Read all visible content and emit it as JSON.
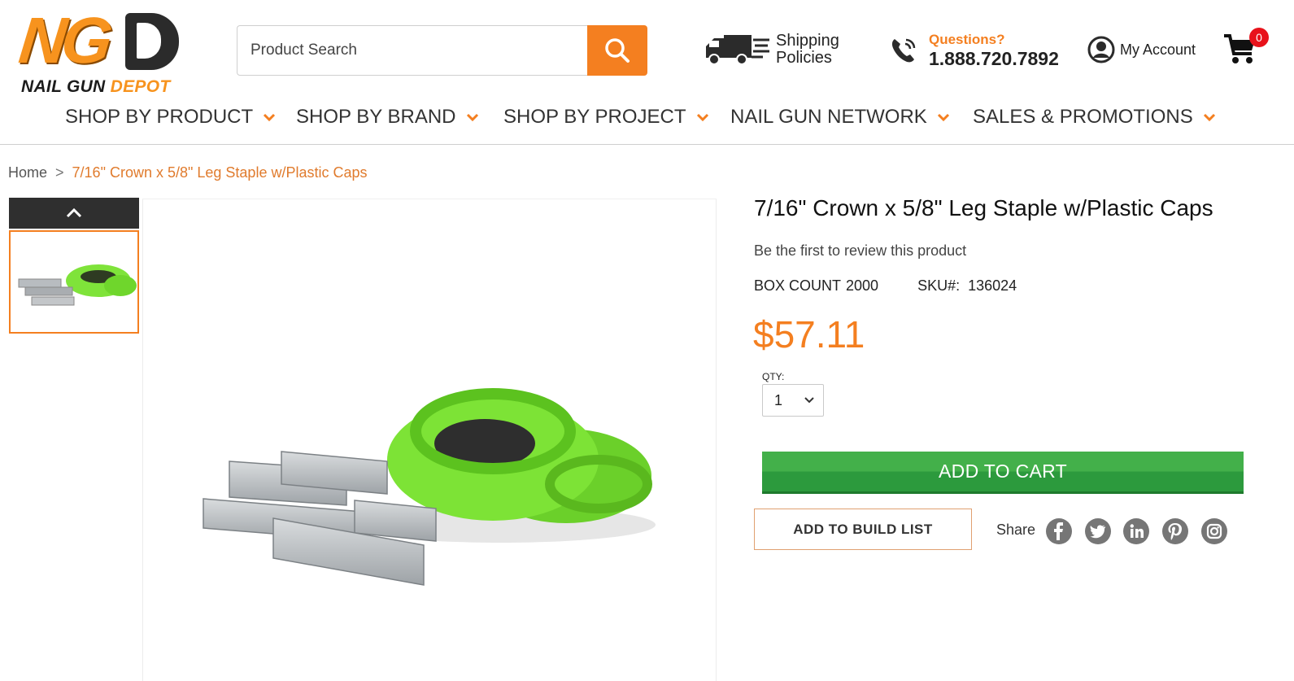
{
  "brand": {
    "logo_mark": "NG",
    "logo_text_nail": "NAIL GUN",
    "logo_text_depot": "DEPOT"
  },
  "search": {
    "placeholder": "Product Search",
    "button_icon": "search-icon"
  },
  "header_links": {
    "shipping_label": "Shipping Policies",
    "questions_label": "Questions?",
    "phone": "1.888.720.7892",
    "account_label": "My Account",
    "cart_count": "0"
  },
  "nav": {
    "items": [
      {
        "label": "SHOP BY PRODUCT"
      },
      {
        "label": "SHOP BY BRAND"
      },
      {
        "label": "SHOP BY PROJECT"
      },
      {
        "label": "NAIL GUN NETWORK"
      },
      {
        "label": "SALES & PROMOTIONS"
      }
    ]
  },
  "breadcrumb": {
    "home": "Home",
    "separator": ">",
    "current": "7/16\" Crown x 5/8\" Leg Staple w/Plastic Caps"
  },
  "product": {
    "title": "7/16\" Crown x 5/8\" Leg Staple w/Plastic Caps",
    "review_text": "Be the first to review this product",
    "box_count_label": "BOX COUNT",
    "box_count_value": "2000",
    "sku_label": "SKU#:",
    "sku_value": "136024",
    "price": "$57.11",
    "qty_label": "QTY:",
    "qty_value": "1",
    "add_to_cart": "ADD TO CART",
    "add_to_build_list": "ADD TO BUILD LIST",
    "share_label": "Share",
    "social_icons": [
      "facebook-icon",
      "twitter-icon",
      "linkedin-icon",
      "pinterest-icon",
      "instagram-icon"
    ]
  },
  "colors": {
    "accent_orange": "#f47f20",
    "cart_green": "#3aa847",
    "badge_red": "#e8121b",
    "nav_text": "#333333"
  }
}
